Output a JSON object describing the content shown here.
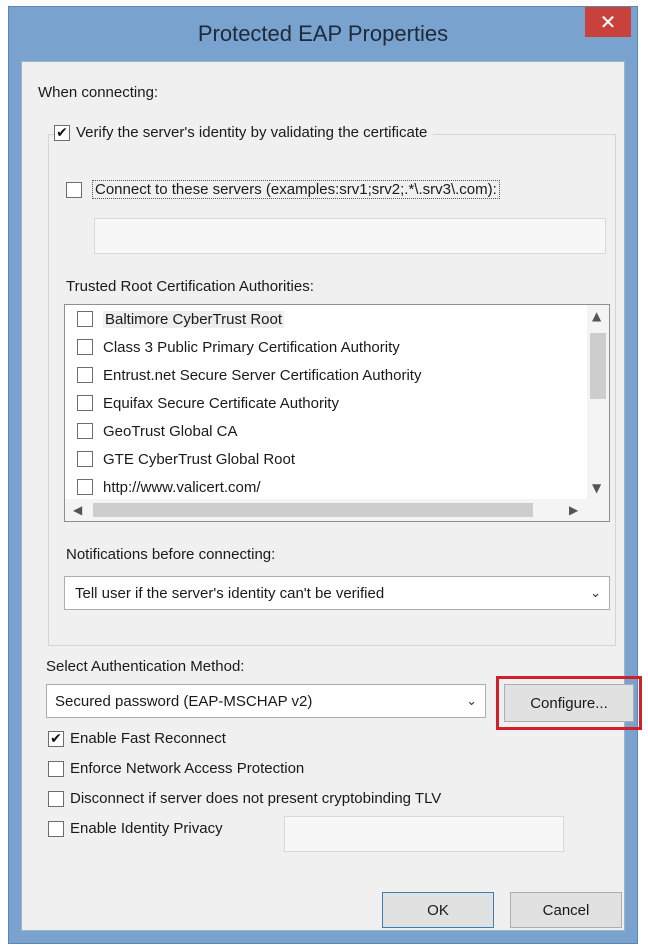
{
  "window": {
    "title": "Protected EAP Properties",
    "close_glyph": "✕"
  },
  "labels": {
    "when_connecting": "When connecting:",
    "verify_server": "Verify the server's identity by validating the certificate",
    "connect_servers": "Connect to these servers (examples:srv1;srv2;.*\\.srv3\\.com):",
    "trusted_root": "Trusted Root Certification Authorities:",
    "notifications": "Notifications before connecting:",
    "select_auth": "Select Authentication Method:"
  },
  "checkboxes": {
    "verify_server": true,
    "connect_servers": false,
    "fast_reconnect": true,
    "enforce_nap": false,
    "disconnect_crypto": false,
    "identity_privacy": false
  },
  "connect_servers_value": "",
  "ca_list": [
    {
      "label": "Baltimore CyberTrust Root",
      "checked": false
    },
    {
      "label": "Class 3 Public Primary Certification Authority",
      "checked": false
    },
    {
      "label": "Entrust.net Secure Server Certification Authority",
      "checked": false
    },
    {
      "label": "Equifax Secure Certificate Authority",
      "checked": false
    },
    {
      "label": "GeoTrust Global CA",
      "checked": false
    },
    {
      "label": "GTE CyberTrust Global Root",
      "checked": false
    },
    {
      "label": "http://www.valicert.com/",
      "checked": false
    }
  ],
  "notifications_value": "Tell user if the server's identity can't be verified",
  "auth_method_value": "Secured password (EAP-MSCHAP v2)",
  "buttons": {
    "configure": "Configure...",
    "ok": "OK",
    "cancel": "Cancel"
  },
  "options": {
    "fast_reconnect": "Enable Fast Reconnect",
    "enforce_nap": "Enforce Network Access Protection",
    "disconnect_crypto": "Disconnect if server does not present cryptobinding TLV",
    "identity_privacy": "Enable Identity Privacy"
  },
  "identity_privacy_value": "",
  "icons": {
    "checkmark": "✔",
    "chevron_down": "⌄",
    "arrow_up": "▲",
    "arrow_down": "▼",
    "arrow_left": "◀",
    "arrow_right": "▶"
  },
  "colors": {
    "highlight": "#d0202a",
    "close": "#c8413a",
    "frame": "#7aa2cf"
  }
}
